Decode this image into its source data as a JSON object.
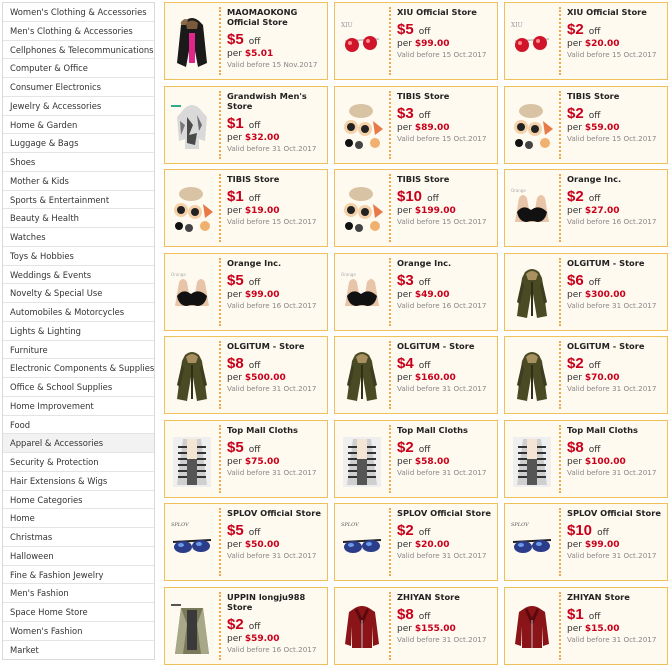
{
  "sidebar": {
    "active": "Apparel & Accessories",
    "categories": [
      "Women's Clothing & Accessories",
      "Men's Clothing & Accessories",
      "Cellphones & Telecommunications",
      "Computer & Office",
      "Consumer Electronics",
      "Jewelry & Accessories",
      "Home & Garden",
      "Luggage & Bags",
      "Shoes",
      "Mother & Kids",
      "Sports & Entertainment",
      "Beauty & Health",
      "Watches",
      "Toys & Hobbies",
      "Weddings & Events",
      "Novelty & Special Use",
      "Automobiles & Motorcycles",
      "Lights & Lighting",
      "Furniture",
      "Electronic Components & Supplies",
      "Office & School Supplies",
      "Home Improvement",
      "Food",
      "Apparel & Accessories",
      "Security & Protection",
      "Hair Extensions & Wigs",
      "Home Categories",
      "Home",
      "Christmas",
      "Halloween",
      "Fine & Fashion Jewelry",
      "Men's Fashion",
      "Space Home Store",
      "Women's Fashion",
      "Market"
    ]
  },
  "labels": {
    "off": "off",
    "per": "per"
  },
  "coupons": [
    {
      "store": "MAOMAOKONG Official Store",
      "amount": "$5",
      "per": "$5.01",
      "valid": "Valid before 15 Nov.2017",
      "icon": "coat-icon"
    },
    {
      "store": "XIU Official Store",
      "amount": "$5",
      "per": "$99.00",
      "valid": "Valid before 15 Oct.2017",
      "icon": "sunglasses-icon"
    },
    {
      "store": "XIU Official Store",
      "amount": "$2",
      "per": "$20.00",
      "valid": "Valid before 15 Oct.2017",
      "icon": "sunglasses-icon"
    },
    {
      "store": "Grandwish Men's Store",
      "amount": "$1",
      "per": "$32.00",
      "valid": "Valid before 31 Oct.2017",
      "icon": "hoodie-icon"
    },
    {
      "store": "TIBIS Store",
      "amount": "$3",
      "per": "$89.00",
      "valid": "Valid before 15 Oct.2017",
      "icon": "hair-accessories-icon"
    },
    {
      "store": "TIBIS Store",
      "amount": "$2",
      "per": "$59.00",
      "valid": "Valid before 15 Oct.2017",
      "icon": "hair-accessories-icon"
    },
    {
      "store": "TIBIS Store",
      "amount": "$1",
      "per": "$19.00",
      "valid": "Valid before 15 Oct.2017",
      "icon": "hair-accessories-icon"
    },
    {
      "store": "TIBIS Store",
      "amount": "$10",
      "per": "$199.00",
      "valid": "Valid before 15 Oct.2017",
      "icon": "hair-accessories-icon"
    },
    {
      "store": "Orange Inc.",
      "amount": "$2",
      "per": "$27.00",
      "valid": "Valid before 16 Oct.2017",
      "icon": "bra-icon"
    },
    {
      "store": "Orange Inc.",
      "amount": "$5",
      "per": "$99.00",
      "valid": "Valid before 16 Oct.2017",
      "icon": "bra-icon"
    },
    {
      "store": "Orange Inc.",
      "amount": "$3",
      "per": "$49.00",
      "valid": "Valid before 16 Oct.2017",
      "icon": "bra-icon"
    },
    {
      "store": "OLGITUM - Store",
      "amount": "$6",
      "per": "$300.00",
      "valid": "Valid before 31 Oct.2017",
      "icon": "parka-icon"
    },
    {
      "store": "OLGITUM - Store",
      "amount": "$8",
      "per": "$500.00",
      "valid": "Valid before 31 Oct.2017",
      "icon": "parka-icon"
    },
    {
      "store": "OLGITUM - Store",
      "amount": "$4",
      "per": "$160.00",
      "valid": "Valid before 31 Oct.2017",
      "icon": "parka-icon"
    },
    {
      "store": "OLGITUM - Store",
      "amount": "$2",
      "per": "$70.00",
      "valid": "Valid before 31 Oct.2017",
      "icon": "parka-icon"
    },
    {
      "store": "Top Mall Cloths",
      "amount": "$5",
      "per": "$75.00",
      "valid": "Valid before 31 Oct.2017",
      "icon": "cardigan-icon"
    },
    {
      "store": "Top Mall Cloths",
      "amount": "$2",
      "per": "$58.00",
      "valid": "Valid before 31 Oct.2017",
      "icon": "cardigan-icon"
    },
    {
      "store": "Top Mall Cloths",
      "amount": "$8",
      "per": "$100.00",
      "valid": "Valid before 31 Oct.2017",
      "icon": "cardigan-icon"
    },
    {
      "store": "SPLOV Official Store",
      "amount": "$5",
      "per": "$50.00",
      "valid": "Valid before 31 Oct.2017",
      "icon": "goggles-icon"
    },
    {
      "store": "SPLOV Official Store",
      "amount": "$2",
      "per": "$20.00",
      "valid": "Valid before 31 Oct.2017",
      "icon": "goggles-icon"
    },
    {
      "store": "SPLOV Official Store",
      "amount": "$10",
      "per": "$99.00",
      "valid": "Valid before 31 Oct.2017",
      "icon": "goggles-icon"
    },
    {
      "store": "UPPIN longju988 Store",
      "amount": "$2",
      "per": "$59.00",
      "valid": "Valid before 16 Oct.2017",
      "icon": "fur-coat-icon"
    },
    {
      "store": "ZHIYAN Store",
      "amount": "$8",
      "per": "$155.00",
      "valid": "Valid before 31 Oct.2017",
      "icon": "leather-jacket-icon"
    },
    {
      "store": "ZHIYAN Store",
      "amount": "$1",
      "per": "$15.00",
      "valid": "Valid before 31 Oct.2017",
      "icon": "leather-jacket-icon"
    }
  ],
  "thumb_brand_text": {
    "sunglasses-icon": "XIU",
    "goggles-icon": "SPLOV"
  },
  "colors": {
    "accent_red": "#c8001b",
    "card_border": "#f0c05a",
    "card_bg": "#fffaf0",
    "perforation": "#f0a84a"
  }
}
